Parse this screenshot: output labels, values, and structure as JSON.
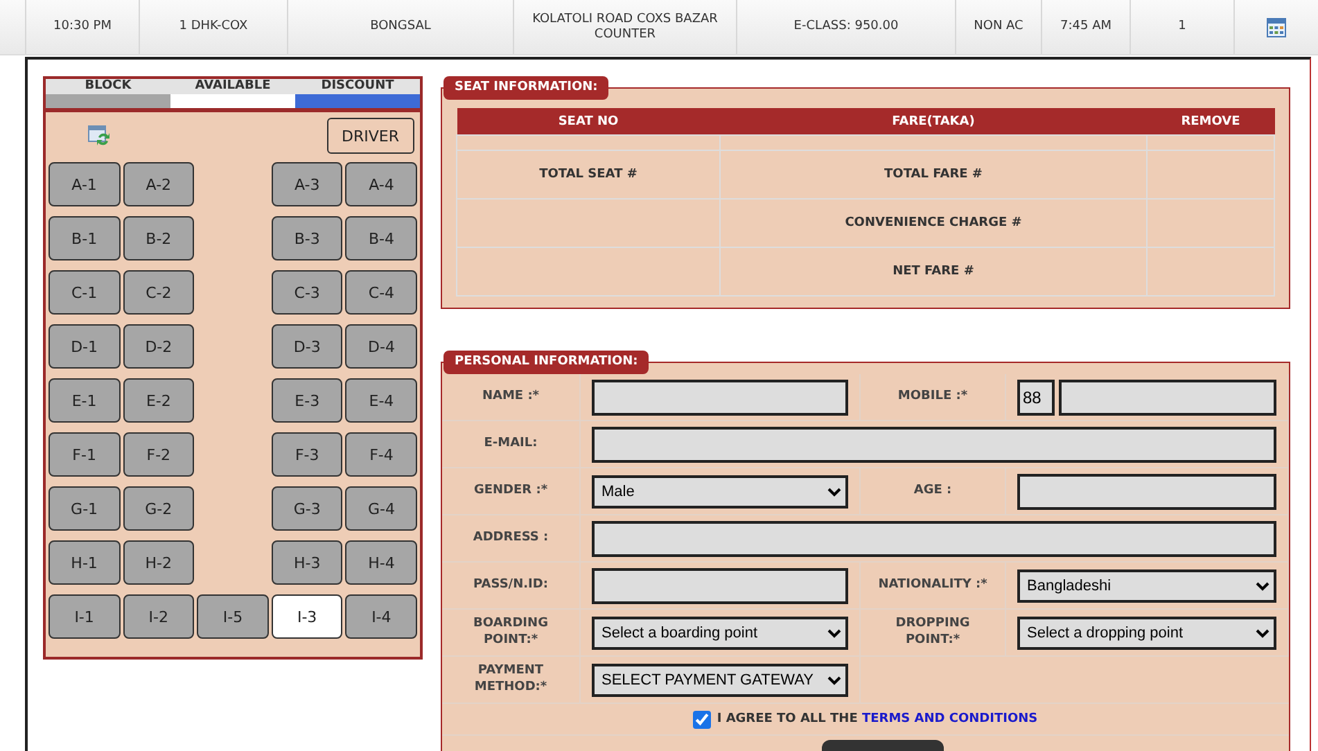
{
  "trip_row": {
    "cells": [
      "10:30 PM",
      "1 DHK-COX",
      "BONGSAL",
      "KOLATOLI ROAD COXS BAZAR COUNTER",
      "E-CLASS: 950.00",
      "NON AC",
      "7:45 AM",
      "1"
    ]
  },
  "seat_legend": [
    {
      "label": "BLOCK",
      "color": "#a6a6a6"
    },
    {
      "label": "AVAILABLE",
      "color": "#ffffff"
    },
    {
      "label": "DISCOUNT",
      "color": "#3d6bd6"
    }
  ],
  "driver_button": "DRIVER",
  "seat_rows": [
    {
      "seats": [
        {
          "label": "A-1",
          "blocked": true
        },
        {
          "label": "A-2",
          "blocked": true
        },
        {
          "label": "A-3",
          "blocked": true
        },
        {
          "label": "A-4",
          "blocked": true
        }
      ]
    },
    {
      "seats": [
        {
          "label": "B-1",
          "blocked": true
        },
        {
          "label": "B-2",
          "blocked": true
        },
        {
          "label": "B-3",
          "blocked": true
        },
        {
          "label": "B-4",
          "blocked": true
        }
      ]
    },
    {
      "seats": [
        {
          "label": "C-1",
          "blocked": true
        },
        {
          "label": "C-2",
          "blocked": true
        },
        {
          "label": "C-3",
          "blocked": true
        },
        {
          "label": "C-4",
          "blocked": true
        }
      ]
    },
    {
      "seats": [
        {
          "label": "D-1",
          "blocked": true
        },
        {
          "label": "D-2",
          "blocked": true
        },
        {
          "label": "D-3",
          "blocked": true
        },
        {
          "label": "D-4",
          "blocked": true
        }
      ]
    },
    {
      "seats": [
        {
          "label": "E-1",
          "blocked": true
        },
        {
          "label": "E-2",
          "blocked": true
        },
        {
          "label": "E-3",
          "blocked": true
        },
        {
          "label": "E-4",
          "blocked": true
        }
      ]
    },
    {
      "seats": [
        {
          "label": "F-1",
          "blocked": true
        },
        {
          "label": "F-2",
          "blocked": true
        },
        {
          "label": "F-3",
          "blocked": true
        },
        {
          "label": "F-4",
          "blocked": true
        }
      ]
    },
    {
      "seats": [
        {
          "label": "G-1",
          "blocked": true
        },
        {
          "label": "G-2",
          "blocked": true
        },
        {
          "label": "G-3",
          "blocked": true
        },
        {
          "label": "G-4",
          "blocked": true
        }
      ]
    },
    {
      "seats": [
        {
          "label": "H-1",
          "blocked": true
        },
        {
          "label": "H-2",
          "blocked": true
        },
        {
          "label": "H-3",
          "blocked": true
        },
        {
          "label": "H-4",
          "blocked": true
        }
      ]
    },
    {
      "seats": [
        {
          "label": "I-1",
          "blocked": true
        },
        {
          "label": "I-2",
          "blocked": true
        },
        {
          "label": "I-5",
          "blocked": true
        },
        {
          "label": "I-3",
          "blocked": false
        },
        {
          "label": "I-4",
          "blocked": true
        }
      ]
    }
  ],
  "seat_information": {
    "title": "SEAT INFORMATION:",
    "columns": [
      "SEAT NO",
      "FARE(TAKA)",
      "REMOVE"
    ],
    "summary": [
      {
        "seat_cell": "TOTAL SEAT #",
        "fare_cell": "TOTAL FARE #"
      },
      {
        "fare_cell": "CONVENIENCE CHARGE #"
      },
      {
        "fare_cell": "NET FARE #"
      }
    ]
  },
  "personal_information": {
    "title": "PERSONAL INFORMATION:",
    "rows": [
      {
        "fields": [
          {
            "label": "NAME :*",
            "kind": "text"
          },
          {
            "label": "MOBILE :*",
            "kind": "phone",
            "value": "88"
          }
        ]
      },
      {
        "fields": [
          {
            "label": "E-MAIL:",
            "kind": "text"
          }
        ]
      },
      {
        "fields": [
          {
            "label": "GENDER :*",
            "kind": "select",
            "value": "Male"
          },
          {
            "label": "AGE :",
            "kind": "text"
          }
        ]
      },
      {
        "fields": [
          {
            "label": "ADDRESS :",
            "kind": "text"
          }
        ]
      },
      {
        "fields": [
          {
            "label": "PASS/N.ID:",
            "kind": "text"
          },
          {
            "label": "NATIONALITY :*",
            "kind": "select",
            "value": "Bangladeshi"
          }
        ]
      },
      {
        "fields": [
          {
            "label": "BOARDING POINT:*",
            "kind": "select",
            "value": "Select a boarding point"
          },
          {
            "label": "DROPPING POINT:*",
            "kind": "select",
            "value": "Select a dropping point"
          }
        ]
      },
      {
        "fields": [
          {
            "label": "PAYMENT METHOD:*",
            "kind": "select",
            "value": "SELECT PAYMENT GATEWAY"
          }
        ]
      }
    ],
    "agree": {
      "checked": true,
      "text": "I AGREE TO ALL THE",
      "link": "TERMS AND CONDITIONS"
    }
  }
}
